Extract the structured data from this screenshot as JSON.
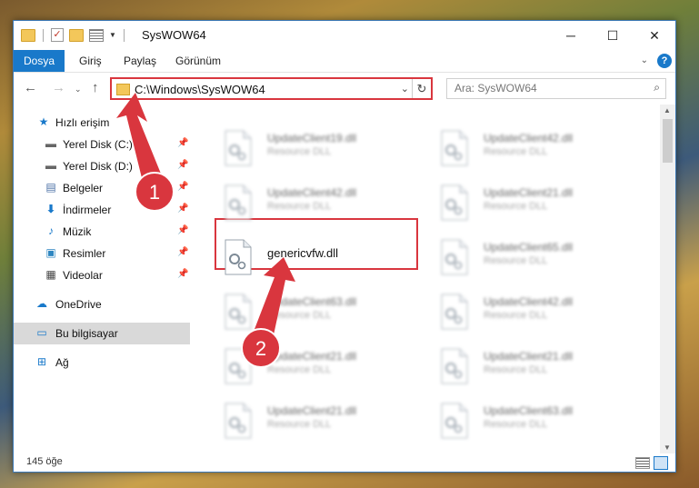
{
  "window": {
    "title": "SysWOW64",
    "controls": {
      "minimize": "─",
      "maximize": "☐",
      "close": "✕"
    }
  },
  "ribbon": {
    "tabs": [
      "Dosya",
      "Giriş",
      "Paylaş",
      "Görünüm"
    ],
    "help": "?"
  },
  "nav": {
    "address": "C:\\Windows\\SysWOW64",
    "search_placeholder": "Ara: SysWOW64"
  },
  "sidebar": {
    "items": [
      {
        "label": "Hızlı erişim",
        "icon": "star-icon"
      },
      {
        "label": "Yerel Disk (C:)",
        "icon": "drive-icon"
      },
      {
        "label": "Yerel Disk (D:)",
        "icon": "drive-icon"
      },
      {
        "label": "Belgeler",
        "icon": "documents-icon"
      },
      {
        "label": "İndirmeler",
        "icon": "download-icon"
      },
      {
        "label": "Müzik",
        "icon": "music-icon"
      },
      {
        "label": "Resimler",
        "icon": "pictures-icon"
      },
      {
        "label": "Videolar",
        "icon": "videos-icon"
      },
      {
        "label": "OneDrive",
        "icon": "cloud-icon"
      },
      {
        "label": "Bu bilgisayar",
        "icon": "computer-icon"
      },
      {
        "label": "Ağ",
        "icon": "network-icon"
      }
    ]
  },
  "files": {
    "type_label": "Resource DLL",
    "left": [
      "UpdateClient19.dll",
      "UpdateClient42.dll",
      "genericvfw.dll",
      "UpdateClient63.dll",
      "UpdateClient21.dll",
      "UpdateClient21.dll"
    ],
    "right": [
      "UpdateClient42.dll",
      "UpdateClient21.dll",
      "UpdateClient65.dll",
      "UpdateClient42.dll",
      "UpdateClient21.dll",
      "UpdateClient63.dll"
    ]
  },
  "status": {
    "count": "145 öğe"
  },
  "annotations": {
    "step1": "1",
    "step2": "2",
    "color": "#d9363e"
  }
}
